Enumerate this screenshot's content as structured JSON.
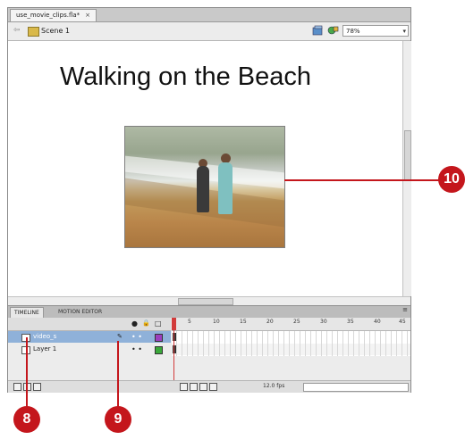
{
  "document": {
    "tab_label": "use_movie_clips.fla*",
    "close_glyph": "×"
  },
  "edit_bar": {
    "back_glyph": "⇦",
    "scene_label": "Scene 1",
    "zoom_value": "78%",
    "zoom_arrow": "▾"
  },
  "stage": {
    "title": "Walking on the Beach"
  },
  "panel": {
    "tabs": [
      "TIMELINE",
      "MOTION EDITOR"
    ],
    "menu_glyph": "≡"
  },
  "timeline": {
    "header_icons": [
      "eye-icon",
      "lock-icon",
      "outline-icon"
    ],
    "header_glyphs": [
      "●",
      "🔒",
      "□"
    ],
    "frame_ticks": [
      "5",
      "10",
      "15",
      "20",
      "25",
      "30",
      "35",
      "40",
      "45"
    ],
    "layers": [
      {
        "name": "video_s",
        "pencil": "✎",
        "dots": "• •",
        "color": "#9c3fbf"
      },
      {
        "name": "Layer 1",
        "pencil": "",
        "dots": "• •",
        "color": "#3aa83a"
      }
    ],
    "footer_readout": "12.0 fps"
  },
  "callouts": {
    "right": "10",
    "left": "8",
    "middle": "9",
    "color": "#c4161c"
  }
}
